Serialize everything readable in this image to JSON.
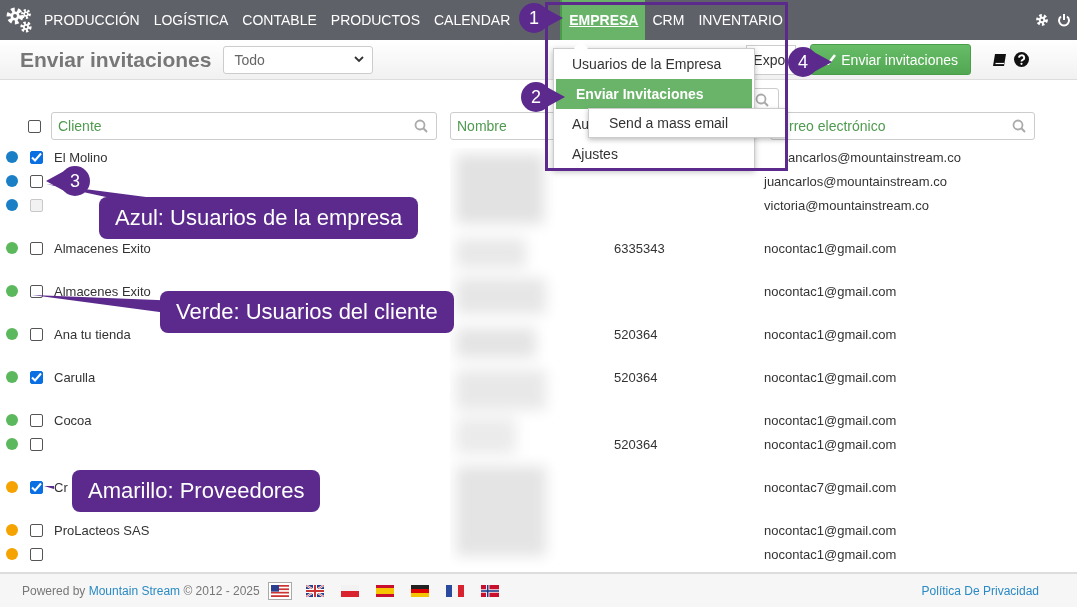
{
  "nav": {
    "items": [
      {
        "label": "PRODUCCIÓN",
        "selected": false
      },
      {
        "label": "LOGÍSTICA",
        "selected": false
      },
      {
        "label": "CONTABLE",
        "selected": false
      },
      {
        "label": "PRODUCTOS",
        "selected": false
      },
      {
        "label": "CALENDAR",
        "selected": false
      },
      {
        "label": "EMPRESA",
        "selected": true
      },
      {
        "label": "CRM",
        "selected": false
      },
      {
        "label": "INVENTARIO",
        "selected": false
      }
    ]
  },
  "header": {
    "title": "Enviar invitaciones",
    "filter": {
      "value": "Todo"
    },
    "export_button": "Expo",
    "send_button": "Enviar invitaciones"
  },
  "menu": {
    "items": [
      {
        "label": "Usuarios de la Empresa",
        "selected": false
      },
      {
        "label": "Enviar Invitaciones",
        "selected": true
      },
      {
        "label": "Au",
        "selected": false
      },
      {
        "label": "Ajustes",
        "selected": false
      }
    ],
    "submenu": {
      "items": [
        "Send a mass email"
      ]
    }
  },
  "table": {
    "select_all": {
      "checked": false
    },
    "filters": [
      {
        "placeholder": "Cliente",
        "search_icon": true
      },
      {
        "placeholder": "Nombre"
      },
      {
        "placeholder": "rreo electrónico",
        "search_icon": true
      }
    ],
    "groups": [
      {
        "rows": [
          {
            "color": "#1a7fc4",
            "checked": true,
            "disabled": false,
            "client": "El Molino",
            "email": "ancarlos@mountainstream.co"
          },
          {
            "color": "#1a7fc4",
            "checked": false,
            "disabled": false,
            "email": "juancarlos@mountainstream.co"
          },
          {
            "color": "#1a7fc4",
            "checked": false,
            "disabled": true,
            "email": "victoria@mountainstream.co"
          }
        ]
      },
      {
        "rows": [
          {
            "color": "#5cb85c",
            "checked": false,
            "disabled": false,
            "client": "Almacenes Exito",
            "phone": "6335343",
            "email": "nocontac1@gmail.com"
          }
        ]
      },
      {
        "rows": [
          {
            "color": "#5cb85c",
            "checked": false,
            "disabled": false,
            "client": "Almacenes Exito",
            "email": "nocontac1@gmail.com"
          }
        ]
      },
      {
        "rows": [
          {
            "color": "#5cb85c",
            "checked": false,
            "disabled": false,
            "client": "Ana tu tienda",
            "phone": "520364",
            "email": "nocontac1@gmail.com"
          }
        ]
      },
      {
        "rows": [
          {
            "color": "#5cb85c",
            "checked": true,
            "disabled": false,
            "client": "Carulla",
            "phone": "520364",
            "email": "nocontac1@gmail.com"
          }
        ]
      },
      {
        "rows": [
          {
            "color": "#5cb85c",
            "checked": false,
            "disabled": false,
            "client": "Cocoa",
            "email": "nocontac1@gmail.com"
          },
          {
            "color": "#5cb85c",
            "checked": false,
            "disabled": false,
            "phone": "520364",
            "email": "nocontac1@gmail.com"
          }
        ]
      },
      {
        "rows": [
          {
            "color": "#f5a300",
            "checked": true,
            "disabled": false,
            "client": "Cr",
            "email": "nocontac7@gmail.com"
          }
        ]
      },
      {
        "rows": [
          {
            "color": "#f5a300",
            "checked": false,
            "disabled": false,
            "client": "ProLacteos SAS",
            "email": "nocontac1@gmail.com"
          },
          {
            "color": "#f5a300",
            "checked": false,
            "disabled": false,
            "email": "nocontac1@gmail.com"
          }
        ]
      }
    ]
  },
  "annotations": {
    "markers": [
      "1",
      "2",
      "3",
      "4"
    ],
    "callouts": [
      "Azul: Usuarios de la empresa",
      "Verde: Usuarios del cliente",
      "Amarillo: Proveedores"
    ]
  },
  "footer": {
    "prefix": "Powered by",
    "link": "Mountain Stream",
    "suffix": "© 2012 - 2025",
    "flags": [
      {
        "selected": true
      },
      {
        "selected": false
      },
      {
        "selected": false
      },
      {
        "selected": false
      },
      {
        "selected": false
      },
      {
        "selected": false
      },
      {
        "selected": false
      }
    ],
    "privacy_link": "Política De Privacidad"
  }
}
